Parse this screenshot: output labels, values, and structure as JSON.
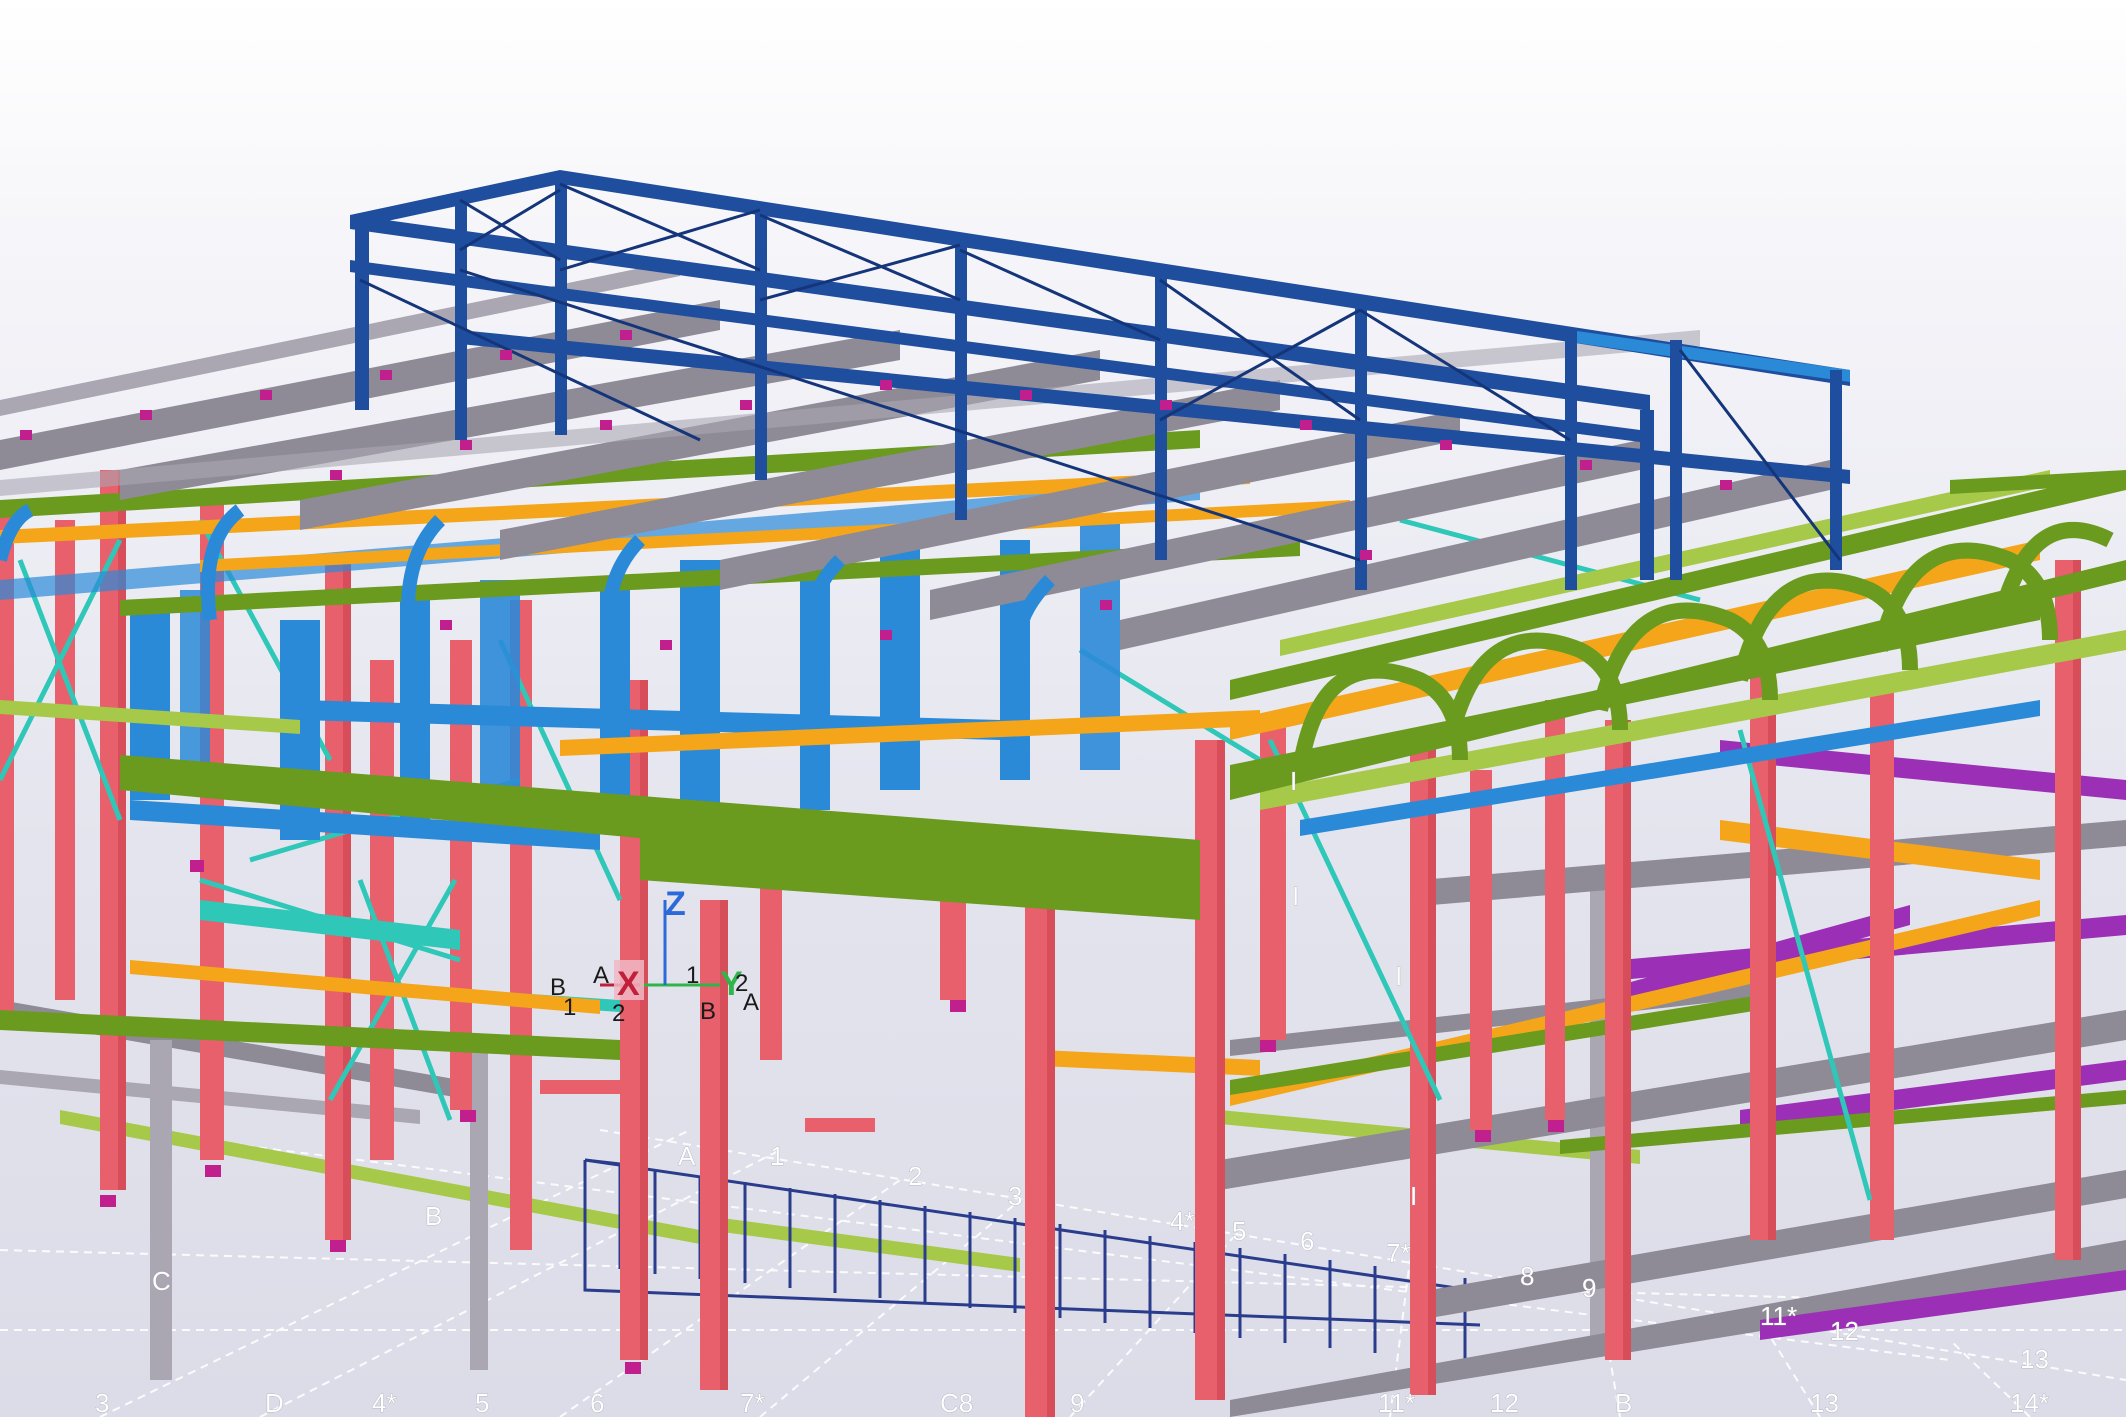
{
  "viewport": {
    "background_top": "#ffffff",
    "background_bottom": "#dcdce8"
  },
  "colors": {
    "column": "#e8606b",
    "column_dark": "#c9404c",
    "roof_frame": "#1f4e9e",
    "roof_frame_dark": "#14357a",
    "gray_beam": "#8e8a96",
    "gray_beam_light": "#aaa6b2",
    "green_beam": "#6a9a1e",
    "green_light": "#a7c94a",
    "cyan_brace": "#2fc7b8",
    "blue_member": "#2b8ad8",
    "orange_beam": "#f4a51a",
    "magenta_beam": "#9b2fb5",
    "magenta_connection": "#c21f8e",
    "dark_rail": "#2a3c8c",
    "grid_line": "#ffffff"
  },
  "grid_labels": {
    "front_row": [
      "3",
      "D",
      "4*",
      "5",
      "6",
      "7*",
      "C8",
      "9",
      "11*",
      "12",
      "B",
      "13",
      "14*"
    ],
    "middle_row": [
      "A",
      "1",
      "2",
      "3",
      "4*",
      "5",
      "6",
      "7*",
      "8",
      "9",
      "11*",
      "12",
      "13"
    ],
    "side": [
      "C",
      "B"
    ]
  },
  "triad": {
    "axis_x": "X",
    "axis_y": "Y",
    "axis_z": "Z",
    "labels": [
      "B",
      "1",
      "A",
      "2",
      "1",
      "B",
      "2",
      "A"
    ]
  },
  "profile_markers": [
    "I",
    "I",
    "I",
    "I"
  ]
}
